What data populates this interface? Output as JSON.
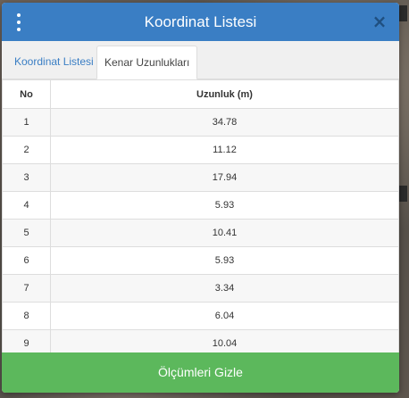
{
  "modal": {
    "title": "Koordinat Listesi",
    "close_symbol": "×",
    "menu_icon": "vertical-ellipsis-icon",
    "close_icon": "close-icon"
  },
  "tabs": [
    {
      "label": "Koordinat Listesi",
      "active": false
    },
    {
      "label": "Kenar Uzunlukları",
      "active": true
    }
  ],
  "table": {
    "headers": [
      "No",
      "Uzunluk (m)"
    ],
    "rows": [
      {
        "no": "1",
        "length": "34.78"
      },
      {
        "no": "2",
        "length": "11.12"
      },
      {
        "no": "3",
        "length": "17.94"
      },
      {
        "no": "4",
        "length": "5.93"
      },
      {
        "no": "5",
        "length": "10.41"
      },
      {
        "no": "6",
        "length": "5.93"
      },
      {
        "no": "7",
        "length": "3.34"
      },
      {
        "no": "8",
        "length": "6.04"
      },
      {
        "no": "9",
        "length": "10.04"
      }
    ]
  },
  "footer": {
    "button_label": "Ölçümleri Gizle"
  },
  "colors": {
    "header_blue": "#3a7ec4",
    "footer_green": "#5cb85c",
    "tab_link_blue": "#3a7ec4"
  }
}
